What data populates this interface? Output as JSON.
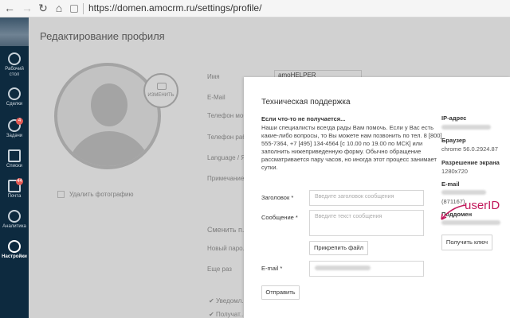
{
  "browser": {
    "back": "←",
    "forward": "→",
    "reload": "↻",
    "home": "⌂",
    "url": "https://domen.amocrm.ru/settings/profile/"
  },
  "sidebar": {
    "items": [
      {
        "label": "Рабочий стол",
        "icon": "speedometer-icon",
        "badge": ""
      },
      {
        "label": "Сделки",
        "icon": "dollar-icon",
        "badge": ""
      },
      {
        "label": "Задачи",
        "icon": "checkmark-icon",
        "badge": "4"
      },
      {
        "label": "Списки",
        "icon": "book-icon",
        "badge": ""
      },
      {
        "label": "Почта",
        "icon": "mail-icon",
        "badge": "44"
      },
      {
        "label": "Аналитика",
        "icon": "chart-icon",
        "badge": ""
      },
      {
        "label": "Настройки",
        "icon": "gear-icon",
        "badge": "",
        "active": true
      }
    ]
  },
  "page": {
    "title": "Редактирование профиля",
    "change_photo": "ИЗМЕНИТЬ",
    "delete_photo": "Удалить фотографию",
    "name_label": "Имя",
    "name_value": "amoHELPER",
    "email_label": "E-Mail",
    "mobile_label": "Телефон моб...",
    "work_phone_label": "Телефон раб...",
    "language_label": "Language / Я...",
    "note_label": "Примечание",
    "change_password": "Сменить п...",
    "new_password_label": "Новый паро...",
    "repeat_label": "Еще раз",
    "notify1": "Уведомл...",
    "notify2": "Получат..."
  },
  "modal": {
    "title": "Техническая поддержка",
    "subtitle": "Если что-то не получается...",
    "text": "Наши специалисты всегда рады Вам помочь. Если у Вас есть какие-либо вопросы, то Вы можете нам позвонить по тел. 8 [800] 555-7364, +7 [495] 134-4564 [с 10.00 по 19.00 по МСК] или заполнить нижеприведенную форму. Обычно обращение рассматривается пару часов, но иногда этот процесс занимает сутки.",
    "subject_label": "Заголовок *",
    "subject_placeholder": "Введите заголовок сообщения",
    "message_label": "Сообщение *",
    "message_placeholder": "Введите текст сообщения",
    "attach_button": "Прикрепить файл",
    "email_label": "E-mail *",
    "send_button": "Отправить",
    "info": {
      "ip_label": "IP-адрес",
      "browser_label": "Браузер",
      "browser_value": "chrome 56.0.2924.87",
      "resolution_label": "Разрешение экрана",
      "resolution_value": "1280x720",
      "email_label": "E-mail",
      "user_id": "(871167)",
      "subdomain_label": "Поддомен",
      "get_key_button": "Получить ключ"
    }
  },
  "annotation": {
    "text": "userID",
    "color": "#c2185b"
  }
}
